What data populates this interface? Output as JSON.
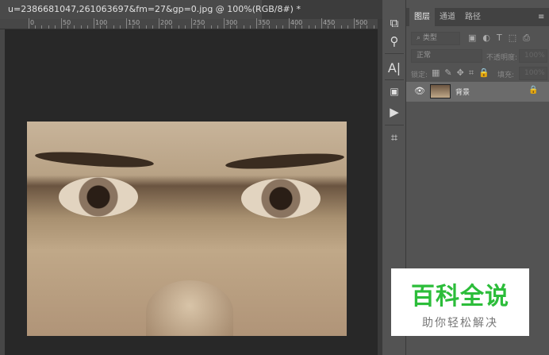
{
  "document": {
    "tab_title": "u=2386681047,261063697&fm=27&gp=0.jpg @ 100%(RGB/8#) *"
  },
  "ruler": {
    "ticks": [
      "0",
      "50",
      "100",
      "150",
      "200",
      "250",
      "300",
      "350",
      "400",
      "450",
      "500"
    ]
  },
  "tools": [
    "puzzle-icon",
    "stamp-icon",
    "character-icon",
    "3d-icon",
    "play-icon",
    "crop-icon"
  ],
  "panel": {
    "tabs": [
      "图层",
      "通道",
      "路径"
    ],
    "filter_label": "类型",
    "blend_mode": "正常",
    "opacity_label": "不透明度:",
    "opacity_value": "100%",
    "lock_label": "锁定:",
    "fill_label": "填充:",
    "fill_value": "100%",
    "layers": [
      {
        "name": "背景",
        "visible": true,
        "locked": true
      }
    ]
  },
  "watermark": {
    "title": "百科全说",
    "subtitle": "助你轻松解决"
  }
}
